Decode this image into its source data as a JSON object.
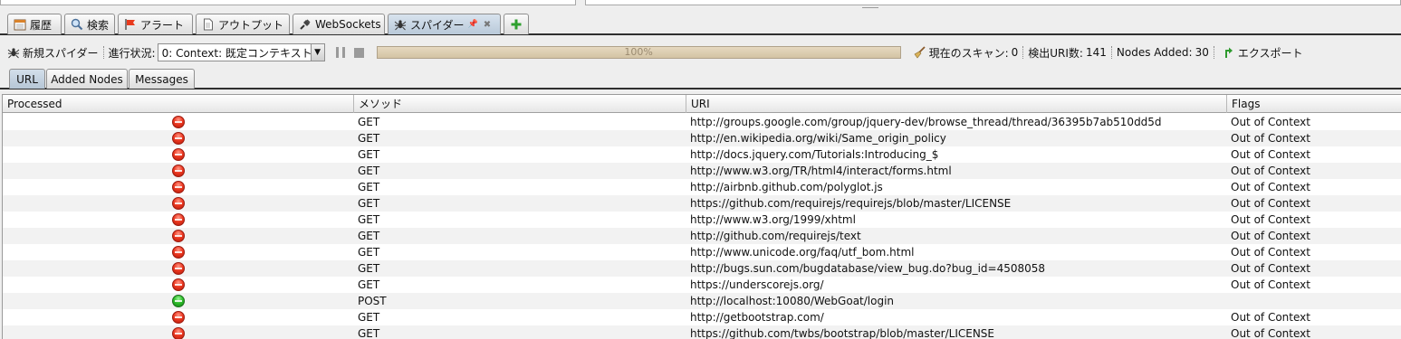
{
  "tabs": [
    {
      "label": "履歴",
      "icon": "calendar-icon",
      "active": false
    },
    {
      "label": "検索",
      "icon": "magnifier-icon",
      "active": false
    },
    {
      "label": "アラート",
      "icon": "flag-icon",
      "active": false
    },
    {
      "label": "アウトプット",
      "icon": "document-icon",
      "active": false
    },
    {
      "label": "WebSockets",
      "icon": "plug-icon",
      "active": false
    },
    {
      "label": "スパイダー",
      "icon": "spider-icon",
      "active": true
    }
  ],
  "toolbar": {
    "new_spider_label": "新規スパイダー",
    "progress_label": "進行状況:",
    "context_select": "0: Context: 既定コンテキスト",
    "progress_percent": 100,
    "progress_text": "100%",
    "current_scan_label": "現在のスキャン:",
    "current_scan_value": "0",
    "found_uri_label": "検出URI数:",
    "found_uri_value": "141",
    "nodes_added_label": "Nodes Added:",
    "nodes_added_value": "30",
    "export_label": "エクスポート"
  },
  "subtabs": [
    {
      "label": "URL",
      "active": true
    },
    {
      "label": "Added Nodes",
      "active": false
    },
    {
      "label": "Messages",
      "active": false
    }
  ],
  "table": {
    "headers": {
      "processed": "Processed",
      "method": "メソッド",
      "uri": "URI",
      "flags": "Flags"
    },
    "rows": [
      {
        "status": "red",
        "method": "GET",
        "uri": "http://groups.google.com/group/jquery-dev/browse_thread/thread/36395b7ab510dd5d",
        "flags": "Out of Context"
      },
      {
        "status": "red",
        "method": "GET",
        "uri": "http://en.wikipedia.org/wiki/Same_origin_policy",
        "flags": "Out of Context"
      },
      {
        "status": "red",
        "method": "GET",
        "uri": "http://docs.jquery.com/Tutorials:Introducing_$",
        "flags": "Out of Context"
      },
      {
        "status": "red",
        "method": "GET",
        "uri": "http://www.w3.org/TR/html4/interact/forms.html",
        "flags": "Out of Context"
      },
      {
        "status": "red",
        "method": "GET",
        "uri": "http://airbnb.github.com/polyglot.js",
        "flags": "Out of Context"
      },
      {
        "status": "red",
        "method": "GET",
        "uri": "https://github.com/requirejs/requirejs/blob/master/LICENSE",
        "flags": "Out of Context"
      },
      {
        "status": "red",
        "method": "GET",
        "uri": "http://www.w3.org/1999/xhtml",
        "flags": "Out of Context"
      },
      {
        "status": "red",
        "method": "GET",
        "uri": "http://github.com/requirejs/text",
        "flags": "Out of Context"
      },
      {
        "status": "red",
        "method": "GET",
        "uri": "http://www.unicode.org/faq/utf_bom.html",
        "flags": "Out of Context"
      },
      {
        "status": "red",
        "method": "GET",
        "uri": "http://bugs.sun.com/bugdatabase/view_bug.do?bug_id=4508058",
        "flags": "Out of Context"
      },
      {
        "status": "red",
        "method": "GET",
        "uri": "https://underscorejs.org/",
        "flags": "Out of Context"
      },
      {
        "status": "green",
        "method": "POST",
        "uri": "http://localhost:10080/WebGoat/login",
        "flags": ""
      },
      {
        "status": "red",
        "method": "GET",
        "uri": "http://getbootstrap.com/",
        "flags": "Out of Context"
      },
      {
        "status": "red",
        "method": "GET",
        "uri": "https://github.com/twbs/bootstrap/blob/master/LICENSE",
        "flags": "Out of Context"
      }
    ]
  }
}
